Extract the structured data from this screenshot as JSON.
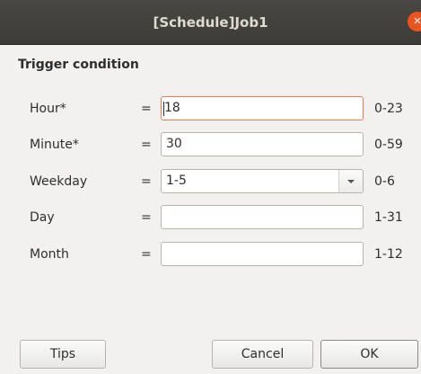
{
  "window": {
    "title": "[Schedule]Job1",
    "close_glyph": "✕"
  },
  "form": {
    "heading": "Trigger condition",
    "rows": [
      {
        "label": "Hour*",
        "eq": "=",
        "value": "18",
        "range": "0-23",
        "focused": true
      },
      {
        "label": "Minute*",
        "eq": "=",
        "value": "30",
        "range": "0-59"
      },
      {
        "label": "Weekday",
        "eq": "=",
        "value": "1-5",
        "range": "0-6",
        "type": "combo"
      },
      {
        "label": "Day",
        "eq": "=",
        "value": "",
        "range": "1-31"
      },
      {
        "label": "Month",
        "eq": "=",
        "value": "",
        "range": "1-12"
      }
    ]
  },
  "buttons": {
    "tips": "Tips",
    "cancel": "Cancel",
    "ok": "OK"
  },
  "colors": {
    "titlebar": "#3c3b37",
    "close": "#e95420",
    "focus_border": "#e97b4f",
    "background": "#f2f1f0"
  }
}
